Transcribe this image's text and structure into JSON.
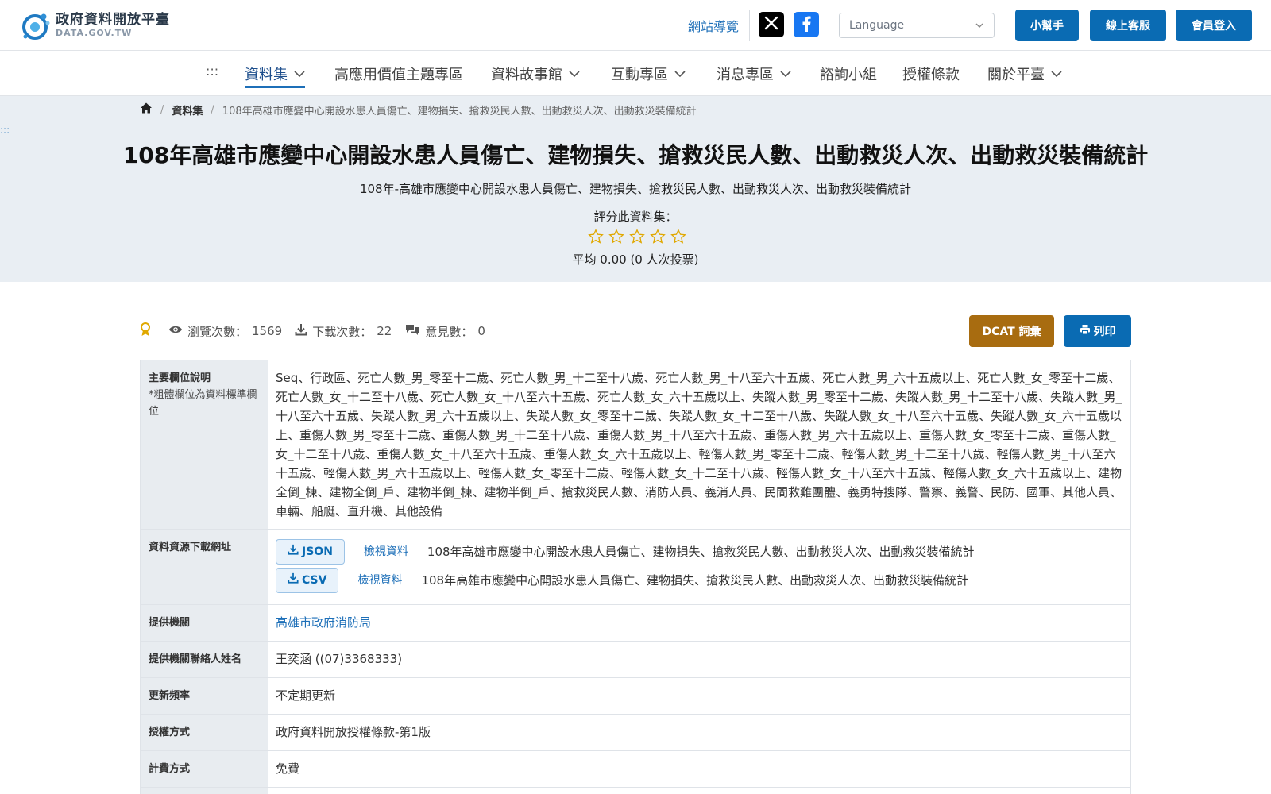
{
  "header": {
    "logo_cn": "政府資料開放平臺",
    "logo_en": "DATA.GOV.TW",
    "sitemap": "網站導覽",
    "language_placeholder": "Language",
    "buttons": {
      "helper": "小幫手",
      "service": "線上客服",
      "login": "會員登入"
    }
  },
  "nav": {
    "accesskey": ":::",
    "items": [
      {
        "label": "資料集",
        "has_dropdown": true,
        "active": true
      },
      {
        "label": "高應用價值主題專區",
        "has_dropdown": false
      },
      {
        "label": "資料故事館",
        "has_dropdown": true
      },
      {
        "label": "互動專區",
        "has_dropdown": true
      },
      {
        "label": "消息專區",
        "has_dropdown": true
      },
      {
        "label": "諮詢小組",
        "has_dropdown": false
      },
      {
        "label": "授權條款",
        "has_dropdown": false
      },
      {
        "label": "關於平臺",
        "has_dropdown": true
      }
    ]
  },
  "breadcrumb": {
    "section": "資料集",
    "current": "108年高雄市應變中心開設水患人員傷亡、建物損失、搶救災民人數、出動救災人次、出動救災裝備統計"
  },
  "side_accesskey": ":::",
  "dataset": {
    "title": "108年高雄市應變中心開設水患人員傷亡、建物損失、搶救災民人數、出動救災人次、出動救災裝備統計",
    "subtitle": "108年-高雄市應變中心開設水患人員傷亡、建物損失、搶救災民人數、出動救災人次、出動救災裝備統計",
    "rating_label": "評分此資料集：",
    "rating_stars": 5,
    "rating_value": 0,
    "rating_avg": "平均 0.00 (0 人次投票)"
  },
  "stats": {
    "views_label": "瀏覽次數：",
    "views": "1569",
    "downloads_label": "下載次數：",
    "downloads": "22",
    "comments_label": "意見數：",
    "comments": "0"
  },
  "actions": {
    "dcat": "DCAT 詞彙",
    "print": "列印"
  },
  "table": {
    "fields": {
      "label": "主要欄位說明",
      "note": "*粗體欄位為資料標準欄位",
      "value": "Seq、行政區、死亡人數_男_零至十二歲、死亡人數_男_十二至十八歲、死亡人數_男_十八至六十五歲、死亡人數_男_六十五歲以上、死亡人數_女_零至十二歲、死亡人數_女_十二至十八歲、死亡人數_女_十八至六十五歲、死亡人數_女_六十五歲以上、失蹤人數_男_零至十二歲、失蹤人數_男_十二至十八歲、失蹤人數_男_十八至六十五歲、失蹤人數_男_六十五歲以上、失蹤人數_女_零至十二歲、失蹤人數_女_十二至十八歲、失蹤人數_女_十八至六十五歲、失蹤人數_女_六十五歲以上、重傷人數_男_零至十二歲、重傷人數_男_十二至十八歲、重傷人數_男_十八至六十五歲、重傷人數_男_六十五歲以上、重傷人數_女_零至十二歲、重傷人數_女_十二至十八歲、重傷人數_女_十八至六十五歲、重傷人數_女_六十五歲以上、輕傷人數_男_零至十二歲、輕傷人數_男_十二至十八歲、輕傷人數_男_十八至六十五歲、輕傷人數_男_六十五歲以上、輕傷人數_女_零至十二歲、輕傷人數_女_十二至十八歲、輕傷人數_女_十八至六十五歲、輕傷人數_女_六十五歲以上、建物全倒_棟、建物全倒_戶、建物半倒_棟、建物半倒_戶、搶救災民人數、消防人員、義消人員、民間救難團體、義勇特搜隊、警察、義警、民防、國軍、其他人員、車輛、船艇、直升機、其他設備"
    },
    "resources": {
      "label": "資料資源下載網址",
      "items": [
        {
          "format": "JSON",
          "view": "檢視資料",
          "name": "108年高雄市應變中心開設水患人員傷亡、建物損失、搶救災民人數、出動救災人次、出動救災裝備統計"
        },
        {
          "format": "CSV",
          "view": "檢視資料",
          "name": "108年高雄市應變中心開設水患人員傷亡、建物損失、搶救災民人數、出動救災人次、出動救災裝備統計"
        }
      ]
    },
    "provider": {
      "label": "提供機關",
      "value": "高雄市政府消防局"
    },
    "contact": {
      "label": "提供機關聯絡人姓名",
      "value": "王奕涵 ((07)3368333)"
    },
    "frequency": {
      "label": "更新頻率",
      "value": "不定期更新"
    },
    "license": {
      "label": "授權方式",
      "value": "政府資料開放授權條款-第1版"
    },
    "fee": {
      "label": "計費方式",
      "value": "免費"
    }
  },
  "colors": {
    "primary": "#0a6bb3",
    "dcat": "#a86c10",
    "hero_bg": "#e9eef3",
    "table_header_bg": "#e8ecf0",
    "link": "#1d6fb8",
    "star": "#e0a800"
  }
}
